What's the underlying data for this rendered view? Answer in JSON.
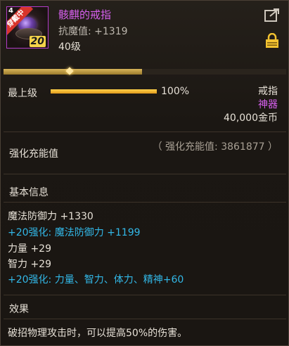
{
  "item": {
    "icon_count": "4",
    "icon_ribbon": "穿戴中",
    "icon_level": "20",
    "name": "骸麒的戒指",
    "magic_resistance": "抗魔值: +1319",
    "level": "40级"
  },
  "header_icons": {
    "share": "share-icon",
    "lock": "lock-icon"
  },
  "top_progress": {
    "fill_fraction": 0.49
  },
  "max_level": {
    "label": "最上级",
    "progress_fraction": 1.0,
    "progress_text": "100%"
  },
  "item_type": "戒指",
  "rarity": "神器",
  "price": "40,000金币",
  "enhance": {
    "title": "强化充能值",
    "value": "（ 强化充能值: 3861877 ）"
  },
  "basic_info": {
    "title": "基本信息",
    "lines": [
      {
        "text": "魔法防御力 +1330",
        "color": "#e6e0d6"
      },
      {
        "text": "+20强化: 魔法防御力 +1199",
        "color": "#32b8e8"
      },
      {
        "text": "力量 +29",
        "color": "#e6e0d6"
      },
      {
        "text": "智力 +29",
        "color": "#e6e0d6"
      },
      {
        "text": "+20强化: 力量、智力、体力、精神+60",
        "color": "#32b8e8"
      }
    ]
  },
  "effect": {
    "title": "效果",
    "text": "破招物理攻击时，可以提高50%的伤害。"
  },
  "colors": {
    "epic_purple": "#d860f0",
    "enhance_cyan": "#32b8e8",
    "gold": "#f5d34a"
  }
}
